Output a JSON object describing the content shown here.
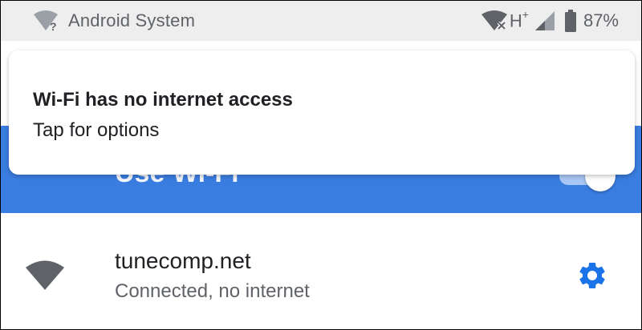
{
  "status_bar": {
    "app_name": "Android System",
    "network_type": "H",
    "network_type_suffix": "+",
    "battery_percent": "87%",
    "icons": [
      "wifi-no-internet-icon",
      "wifi-x-icon",
      "cell-signal-icon",
      "battery-icon"
    ]
  },
  "notification": {
    "title": "Wi-Fi has no internet access",
    "text": "Tap for options"
  },
  "settings_header": {
    "use_wifi_label": "Use Wi-Fi",
    "toggle_on": true,
    "color": "#3a7de0"
  },
  "network": {
    "name": "tunecomp.net",
    "status": "Connected, no internet",
    "icons": [
      "wifi-signal-icon",
      "gear-icon"
    ],
    "accent_color": "#1a73e8"
  }
}
